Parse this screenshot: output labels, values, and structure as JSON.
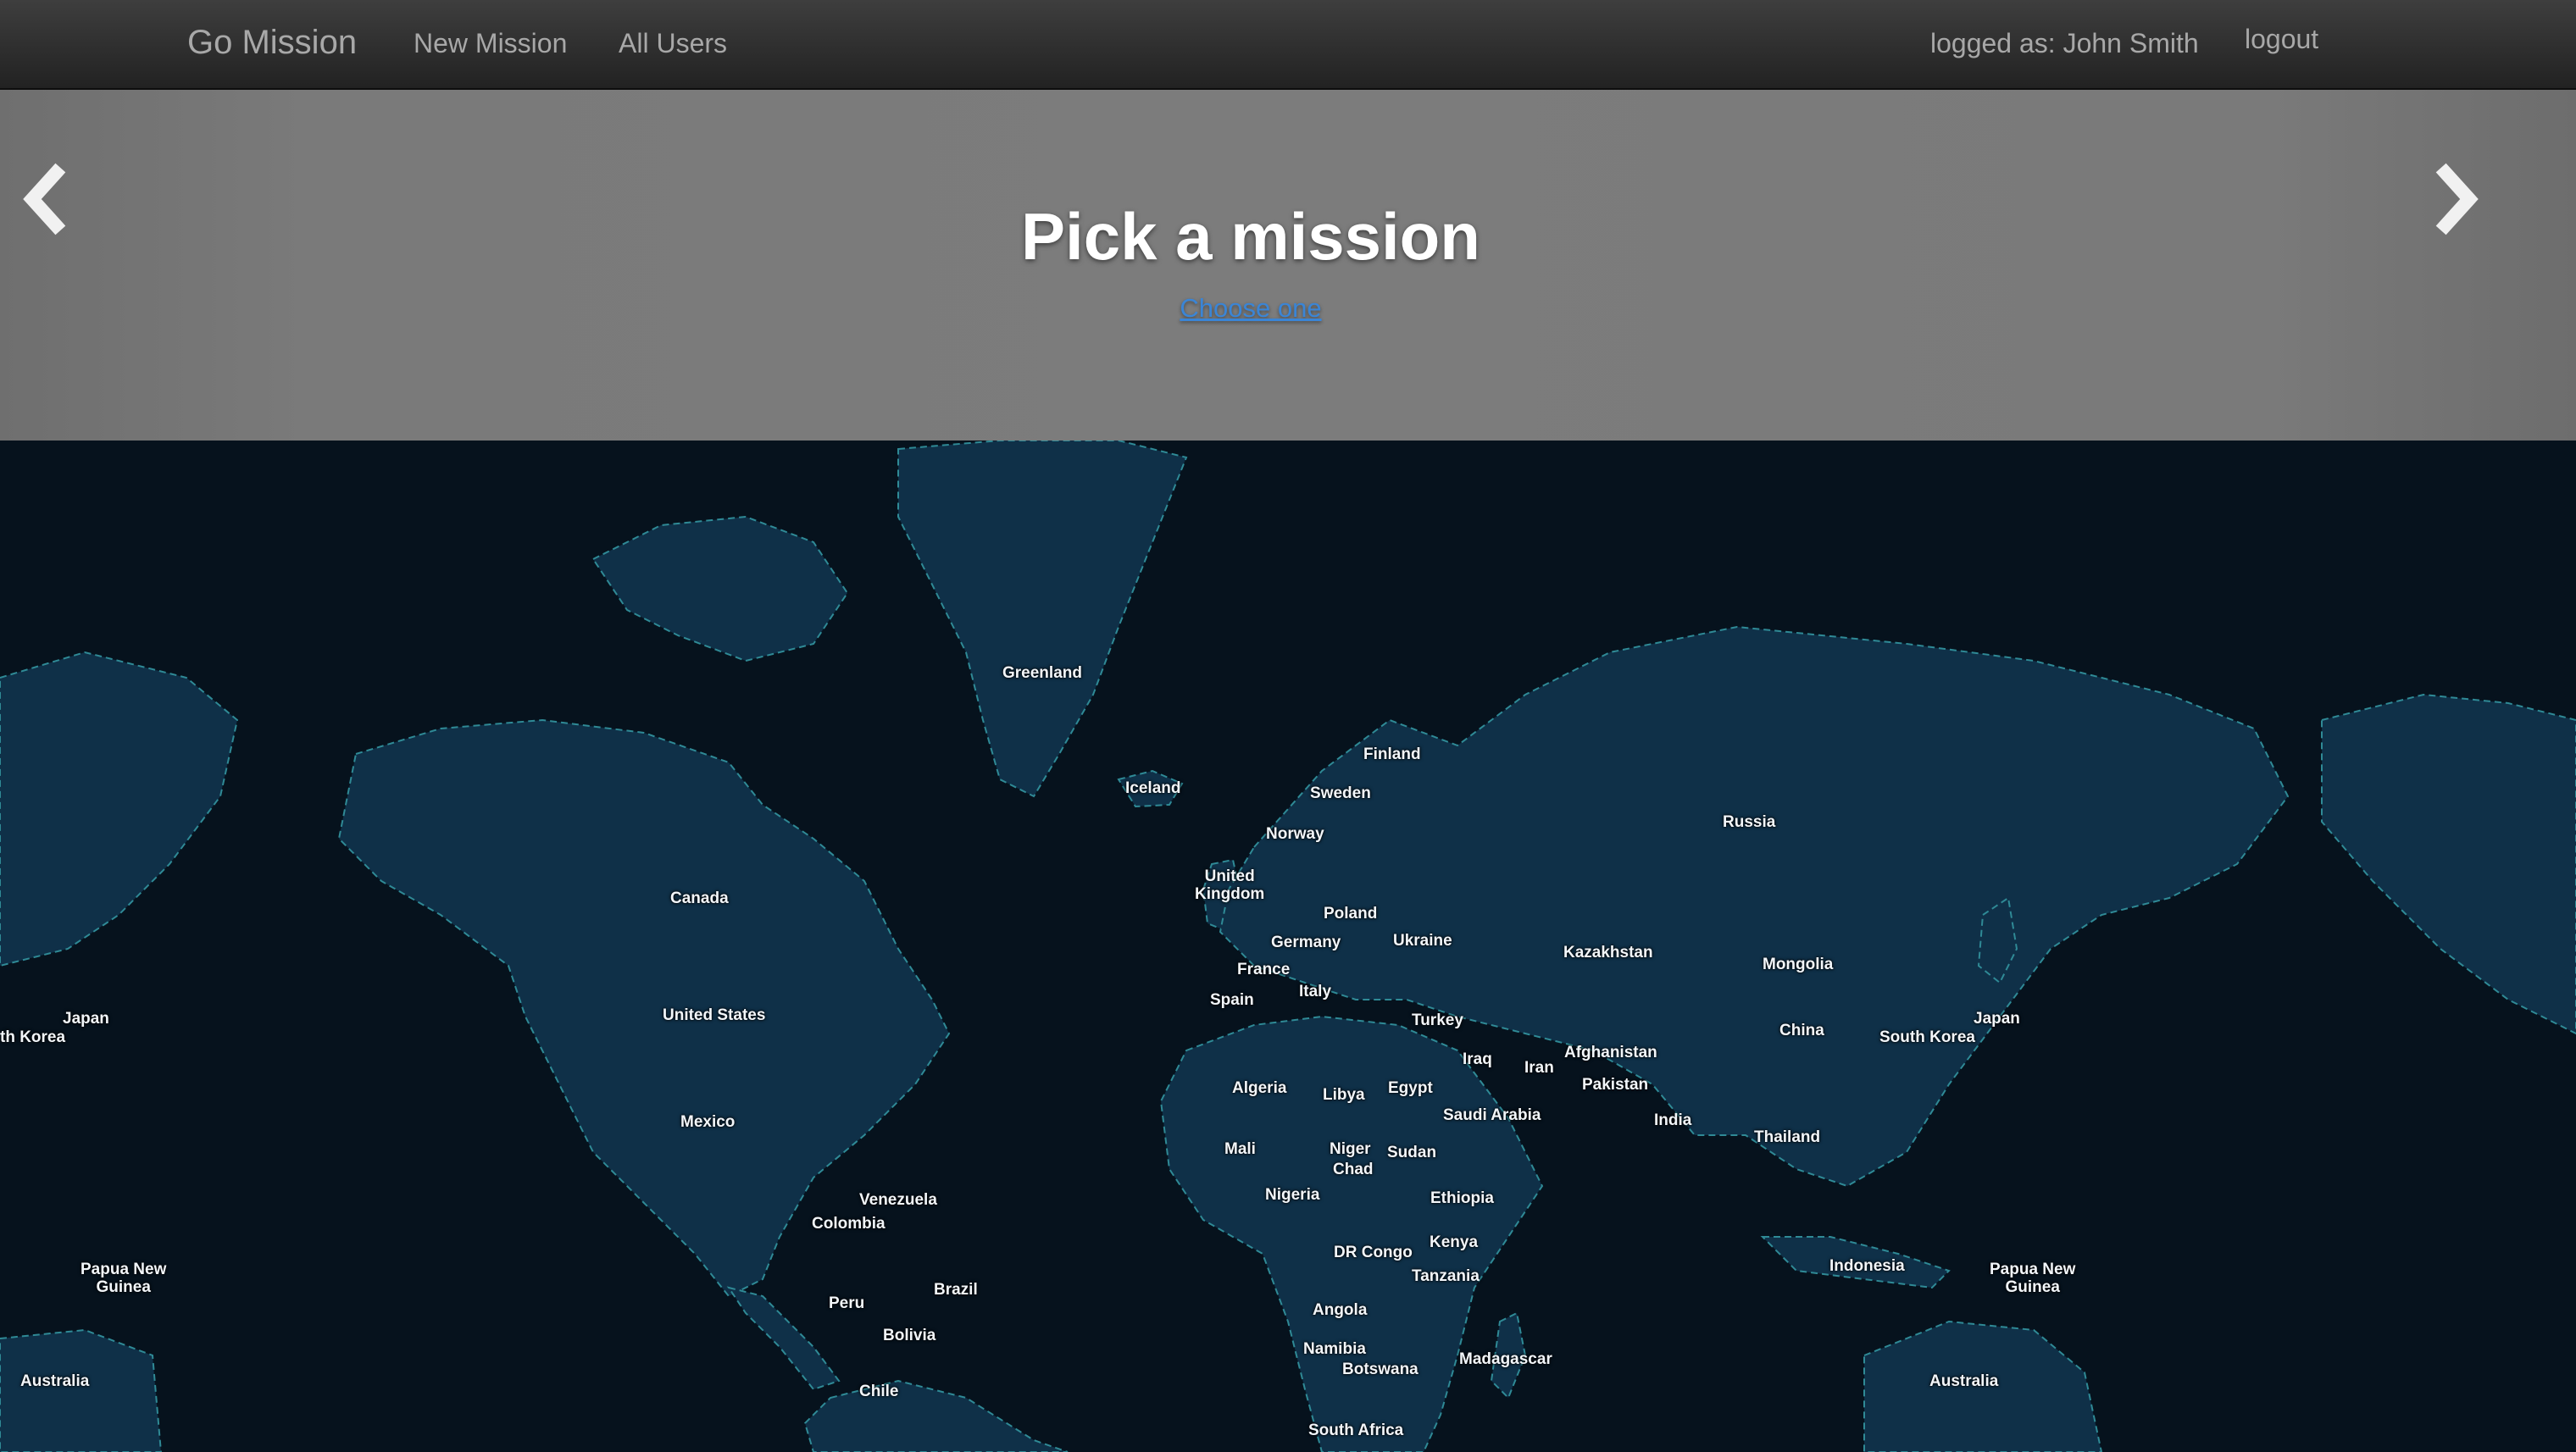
{
  "nav": {
    "brand": "Go Mission",
    "new_mission": "New Mission",
    "all_users": "All Users",
    "logged_user": "logged as: John Smith",
    "logout": "logout"
  },
  "hero": {
    "title": "Pick a mission",
    "subtitle": "Choose one",
    "prev_icon": "chevron-left-icon",
    "next_icon": "chevron-right-icon"
  },
  "map": {
    "countries": {
      "greenland": "Greenland",
      "iceland": "Iceland",
      "finland": "Finland",
      "sweden": "Sweden",
      "norway": "Norway",
      "united_kingdom": "United\nKingdom",
      "russia": "Russia",
      "canada": "Canada",
      "poland": "Poland",
      "germany": "Germany",
      "ukraine": "Ukraine",
      "france": "France",
      "kazakhstan": "Kazakhstan",
      "mongolia": "Mongolia",
      "spain": "Spain",
      "italy": "Italy",
      "japan_left": "Japan",
      "japan_right": "Japan",
      "south_korea_left": "th Korea",
      "south_korea_right": "South Korea",
      "united_states": "United States",
      "turkey": "Turkey",
      "china": "China",
      "afghanistan": "Afghanistan",
      "iraq": "Iraq",
      "iran": "Iran",
      "pakistan": "Pakistan",
      "algeria": "Algeria",
      "libya": "Libya",
      "egypt": "Egypt",
      "saudi_arabia": "Saudi Arabia",
      "mexico": "Mexico",
      "india": "India",
      "thailand": "Thailand",
      "mali": "Mali",
      "niger": "Niger",
      "sudan": "Sudan",
      "chad": "Chad",
      "nigeria": "Nigeria",
      "ethiopia": "Ethiopia",
      "venezuela": "Venezuela",
      "colombia": "Colombia",
      "kenya": "Kenya",
      "dr_congo": "DR Congo",
      "indonesia": "Indonesia",
      "tanzania": "Tanzania",
      "png_left": "Papua New\nGuinea",
      "png_right": "Papua New\nGuinea",
      "brazil": "Brazil",
      "peru": "Peru",
      "angola": "Angola",
      "bolivia": "Bolivia",
      "namibia": "Namibia",
      "botswana": "Botswana",
      "madagascar": "Madagascar",
      "australia_left": "Australia",
      "australia_right": "Australia",
      "chile": "Chile",
      "south_africa": "South Africa"
    },
    "colors": {
      "ocean": "#06121d",
      "land": "#0f3048",
      "border": "#2f8a96"
    }
  }
}
